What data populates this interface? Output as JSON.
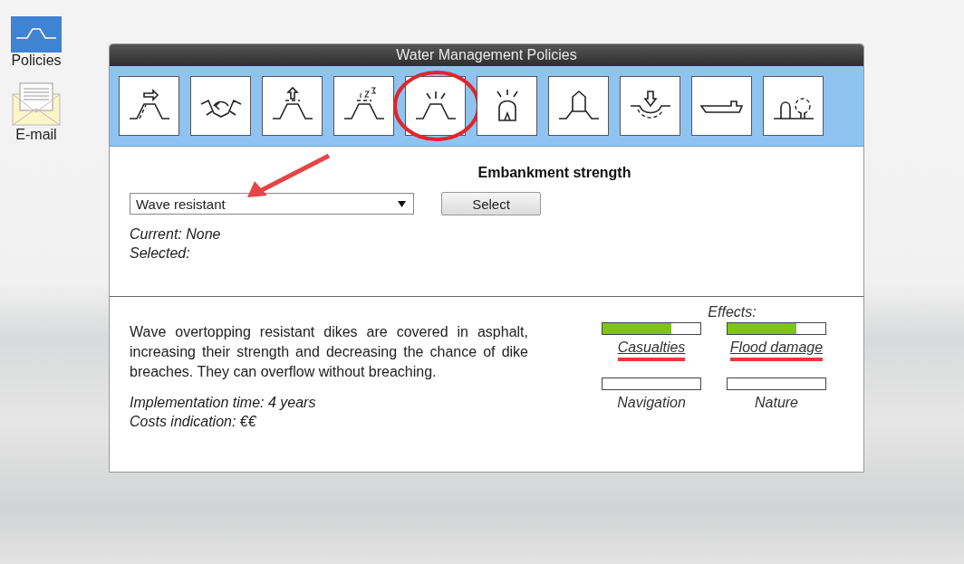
{
  "desktop": {
    "icons": [
      {
        "kind": "policies",
        "label": "Policies"
      },
      {
        "kind": "email",
        "label": "E-mail"
      }
    ]
  },
  "window": {
    "title": "Water Management Policies"
  },
  "policy_buttons": [
    {
      "kind": "relocate",
      "circled": false
    },
    {
      "kind": "cooperate",
      "circled": false
    },
    {
      "kind": "raise",
      "circled": false
    },
    {
      "kind": "prioritize",
      "circled": false
    },
    {
      "kind": "strength",
      "circled": true
    },
    {
      "kind": "alarm",
      "circled": false
    },
    {
      "kind": "house",
      "circled": false
    },
    {
      "kind": "deepen",
      "circled": false
    },
    {
      "kind": "ship",
      "circled": false
    },
    {
      "kind": "nature",
      "circled": false
    }
  ],
  "policy": {
    "heading": "Embankment strength",
    "dropdown_value": "Wave resistant",
    "select_button": "Select",
    "current": "Current: None",
    "selected": "Selected:"
  },
  "description": "Wave overtopping resistant dikes are covered in asphalt, increasing their strength and decreasing the chance of dike breaches. They can overflow without breaching.",
  "implementation_time": "Implementation time: 4 years",
  "costs": "Costs indication: €€",
  "effects": {
    "title": "Effects:",
    "items": [
      {
        "label": "Casualties",
        "level": 0.7,
        "underlined": true
      },
      {
        "label": "Flood damage",
        "level": 0.7,
        "underlined": true
      },
      {
        "label": "Navigation",
        "underlined": false
      },
      {
        "label": "Nature",
        "underlined": false
      }
    ]
  }
}
